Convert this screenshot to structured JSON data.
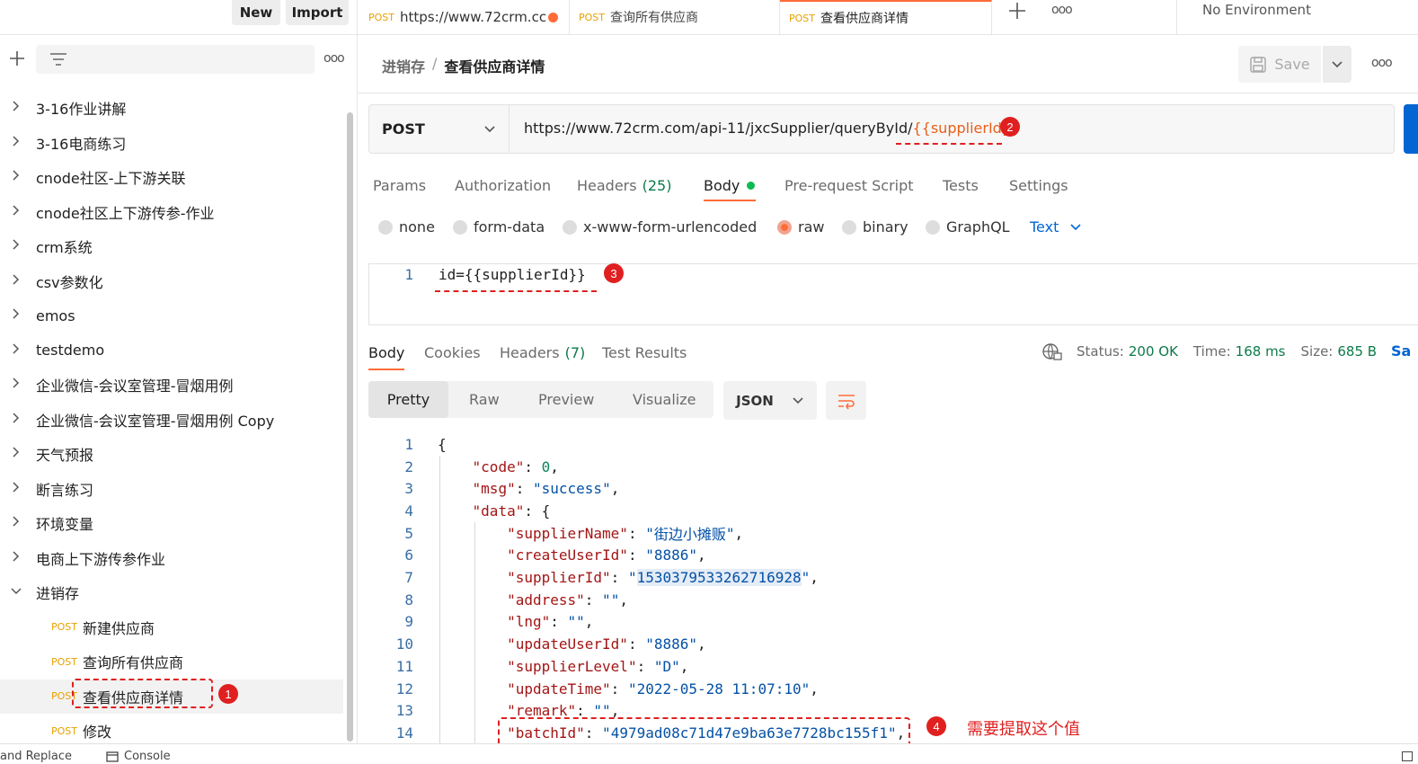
{
  "sidebar": {
    "new_label": "New",
    "import_label": "Import",
    "more": "ooo",
    "collections": [
      "3-16作业讲解",
      "3-16电商练习",
      "cnode社区-上下游关联",
      "cnode社区上下游传参-作业",
      "crm系统",
      "csv参数化",
      "emos",
      "testdemo",
      "企业微信-会议室管理-冒烟用例",
      "企业微信-会议室管理-冒烟用例 Copy",
      "天气预报",
      "断言练习",
      "环境变量",
      "电商上下游传参作业",
      "进销存"
    ],
    "requests": [
      {
        "method": "POST",
        "name": "新建供应商"
      },
      {
        "method": "POST",
        "name": "查询所有供应商"
      },
      {
        "method": "POST",
        "name": "查看供应商详情"
      },
      {
        "method": "POST",
        "name": "修改"
      }
    ]
  },
  "tabs": [
    {
      "method": "POST",
      "title": "https://www.72crm.cc"
    },
    {
      "method": "POST",
      "title": "查询所有供应商"
    },
    {
      "method": "POST",
      "title": "查看供应商详情"
    }
  ],
  "environment": "No Environment",
  "breadcrumb": {
    "parent": "进销存",
    "sep": "/",
    "current": "查看供应商详情"
  },
  "save_label": "Save",
  "request": {
    "method": "POST",
    "url_prefix": "https://www.72crm.com/api-11/jxcSupplier/queryById/",
    "url_var": "{{supplierId}}"
  },
  "request_tabs": {
    "params": "Params",
    "authorization": "Authorization",
    "headers": "Headers",
    "headers_count": "(25)",
    "body": "Body",
    "pre_request": "Pre-request Script",
    "tests": "Tests",
    "settings": "Settings"
  },
  "body_types": {
    "none": "none",
    "form_data": "form-data",
    "urlencoded": "x-www-form-urlencoded",
    "raw": "raw",
    "binary": "binary",
    "graphql": "GraphQL",
    "text": "Text"
  },
  "raw_body": {
    "line": "1",
    "text": "id={{supplierId}}"
  },
  "response_tabs": {
    "body": "Body",
    "cookies": "Cookies",
    "headers": "Headers",
    "headers_count": "(7)",
    "test_results": "Test Results"
  },
  "response_meta": {
    "status_label": "Status:",
    "status": "200 OK",
    "time_label": "Time:",
    "time": "168 ms",
    "size_label": "Size:",
    "size": "685 B",
    "save_cut": "Sa"
  },
  "view_modes": {
    "pretty": "Pretty",
    "raw": "Raw",
    "preview": "Preview",
    "visualize": "Visualize",
    "format": "JSON"
  },
  "response_lines": [
    {
      "n": "1",
      "indent": 0,
      "open": "{"
    },
    {
      "n": "2",
      "indent": 1,
      "key": "code",
      "num": "0",
      "comma": true
    },
    {
      "n": "3",
      "indent": 1,
      "key": "msg",
      "str": "success",
      "comma": true
    },
    {
      "n": "4",
      "indent": 1,
      "key": "data",
      "open": "{"
    },
    {
      "n": "5",
      "indent": 2,
      "key": "supplierName",
      "str": "街边小摊贩",
      "comma": true
    },
    {
      "n": "6",
      "indent": 2,
      "key": "createUserId",
      "str": "8886",
      "comma": true
    },
    {
      "n": "7",
      "indent": 2,
      "key": "supplierId",
      "str": "1530379533262716928",
      "comma": true
    },
    {
      "n": "8",
      "indent": 2,
      "key": "address",
      "str": "",
      "comma": true
    },
    {
      "n": "9",
      "indent": 2,
      "key": "lng",
      "str": "",
      "comma": true
    },
    {
      "n": "10",
      "indent": 2,
      "key": "updateUserId",
      "str": "8886",
      "comma": true
    },
    {
      "n": "11",
      "indent": 2,
      "key": "supplierLevel",
      "str": "D",
      "comma": true
    },
    {
      "n": "12",
      "indent": 2,
      "key": "updateTime",
      "str": "2022-05-28 11:07:10",
      "comma": true
    },
    {
      "n": "13",
      "indent": 2,
      "key": "remark",
      "str": "",
      "comma": true
    },
    {
      "n": "14",
      "indent": 2,
      "key": "batchId",
      "str": "4979ad08c71d47e9ba63e7728bc155f1",
      "comma": true
    }
  ],
  "annotations": {
    "b1": "1",
    "b2": "2",
    "b3": "3",
    "b4": "4",
    "note": "需要提取这个值"
  },
  "footer": {
    "find_replace": "and Replace",
    "console": "Console"
  },
  "colors": {
    "accent": "#ff6c37",
    "annotation": "#e02020",
    "method": "#e8a100",
    "status": "#0c7b4a",
    "link": "#0265d2"
  }
}
